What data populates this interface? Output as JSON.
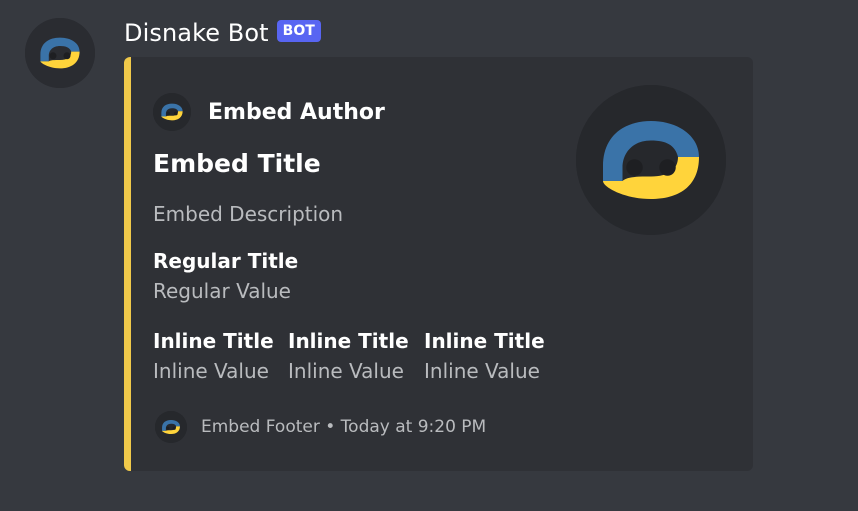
{
  "message": {
    "author": {
      "username": "Disnake Bot",
      "tag": "BOT"
    }
  },
  "embed": {
    "color": "#f0c94a",
    "author": {
      "name": "Embed Author",
      "icon": "disnake-logo-icon"
    },
    "title": "Embed Title",
    "description": "Embed Description",
    "thumbnail": "disnake-logo-icon",
    "fields": [
      {
        "name": "Regular Title",
        "value": "Regular Value",
        "inline": false
      },
      {
        "name": "Inline Title",
        "value": "Inline Value",
        "inline": true
      },
      {
        "name": "Inline Title",
        "value": "Inline Value",
        "inline": true
      },
      {
        "name": "Inline Title",
        "value": "Inline Value",
        "inline": true
      }
    ],
    "footer": {
      "text": "Embed Footer • Today at 9:20 PM",
      "icon": "disnake-logo-icon"
    }
  },
  "colors": {
    "background": "#36393f",
    "embed_background": "#2f3136",
    "bot_tag": "#5865f2",
    "logo_blue": "#3a73a8",
    "logo_yellow": "#ffd43b"
  }
}
